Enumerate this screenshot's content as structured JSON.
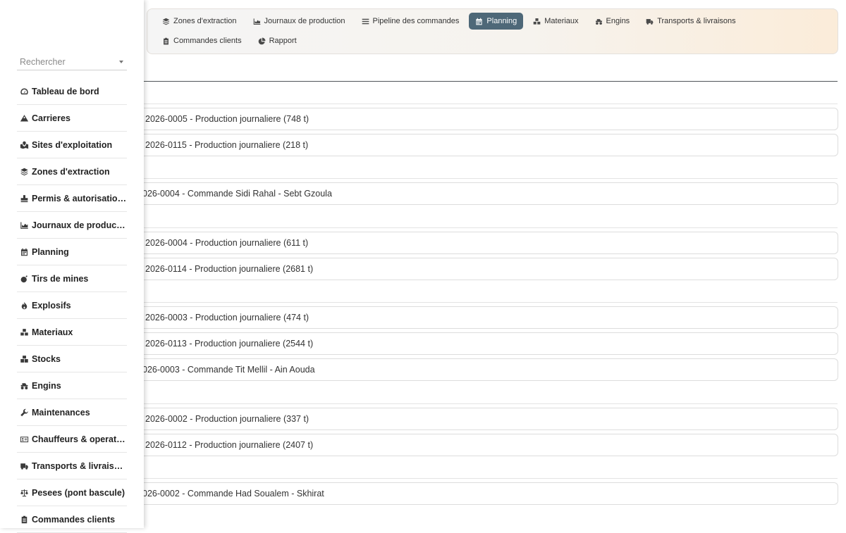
{
  "topnav": {
    "tabs": [
      {
        "label": "Zones d'extraction",
        "icon": "layers-icon",
        "active": false
      },
      {
        "label": "Journaux de production",
        "icon": "chart-area-icon",
        "active": false
      },
      {
        "label": "Pipeline des commandes",
        "icon": "bars-icon",
        "active": false
      },
      {
        "label": "Planning",
        "icon": "calendar-icon",
        "active": true
      },
      {
        "label": "Materiaux",
        "icon": "cubes-icon",
        "active": false
      },
      {
        "label": "Engins",
        "icon": "truck-monster-icon",
        "active": false
      },
      {
        "label": "Transports & livraisons",
        "icon": "truck-icon",
        "active": false
      },
      {
        "label": "Commandes clients",
        "icon": "clipboard-icon",
        "active": false
      },
      {
        "label": "Rapport",
        "icon": "pie-chart-icon",
        "active": false
      }
    ],
    "active_color": "#4e6878"
  },
  "sidebar": {
    "search_placeholder": "Rechercher",
    "items": [
      {
        "label": "Tableau de bord",
        "icon": "gauge-icon"
      },
      {
        "label": "Carrieres",
        "icon": "mountain-icon"
      },
      {
        "label": "Sites d'exploitation",
        "icon": "map-icon"
      },
      {
        "label": "Zones d'extraction",
        "icon": "layers-icon"
      },
      {
        "label": "Permis & autorisations",
        "icon": "stamp-icon"
      },
      {
        "label": "Journaux de production",
        "icon": "chart-area-icon"
      },
      {
        "label": "Planning",
        "icon": "calendar-icon"
      },
      {
        "label": "Tirs de mines",
        "icon": "bomb-icon"
      },
      {
        "label": "Explosifs",
        "icon": "fire-icon"
      },
      {
        "label": "Materiaux",
        "icon": "cubes-icon"
      },
      {
        "label": "Stocks",
        "icon": "boxes-icon"
      },
      {
        "label": "Engins",
        "icon": "truck-monster-icon"
      },
      {
        "label": "Maintenances",
        "icon": "wrench-icon"
      },
      {
        "label": "Chauffeurs & operateurs",
        "icon": "id-card-icon"
      },
      {
        "label": "Transports & livraisons",
        "icon": "truck-icon"
      },
      {
        "label": "Pesees (pont bascule)",
        "icon": "scale-icon"
      },
      {
        "label": "Commandes clients",
        "icon": "clipboard-icon"
      }
    ]
  },
  "planning": {
    "events": [
      "2026-0005 - Production journaliere (748 t)",
      "2026-0115 - Production journaliere (218 t)",
      "026-0004 - Commande Sidi Rahal - Sebt Gzoula",
      "2026-0004 - Production journaliere (611 t)",
      "2026-0114 - Production journaliere (2681 t)",
      "2026-0003 - Production journaliere (474 t)",
      "2026-0113 - Production journaliere (2544 t)",
      "026-0003 - Commande Tit Mellil - Ain Aouda",
      "2026-0002 - Production journaliere (337 t)",
      "2026-0112 - Production journaliere (2407 t)",
      "026-0002 - Commande Had Soualem - Skhirat"
    ]
  }
}
